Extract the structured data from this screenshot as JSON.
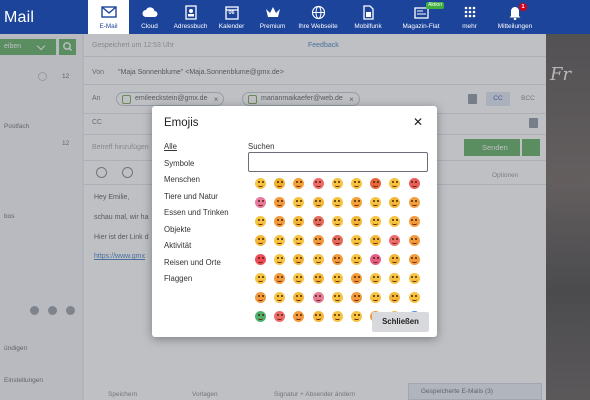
{
  "brand": {
    "name": "Mail"
  },
  "nav": [
    {
      "label": "E-Mail",
      "icon": "envelope-icon",
      "active": true
    },
    {
      "label": "Cloud",
      "icon": "cloud-icon"
    },
    {
      "label": "Adressbuch",
      "icon": "address-book-icon"
    },
    {
      "label": "Kalender",
      "icon": "calendar-icon",
      "day": "06"
    },
    {
      "label": "Premium",
      "icon": "crown-icon"
    },
    {
      "label": "Ihre Webseite",
      "icon": "globe-icon"
    },
    {
      "label": "Mobilfunk",
      "icon": "sim-card-icon"
    },
    {
      "label": "Magazin-Flat",
      "icon": "magazine-icon",
      "pill": "Aktion"
    },
    {
      "label": "mehr",
      "icon": "grid-icon"
    },
    {
      "label": "Mitteilungen",
      "icon": "bell-icon",
      "badge": "1"
    }
  ],
  "sidebar": {
    "compose_label": "eiben",
    "folder_count_1": "12",
    "folder_label_1": "Postfach",
    "folder_count_2": "12",
    "folder_label_3": "bos",
    "bottom_item_1": "ündigen",
    "bottom_item_2": "Einstellungen"
  },
  "compose": {
    "autosave": "Gespeichert um 12:53 Uhr",
    "feedback": "Feedback",
    "from_label": "Von",
    "from_value": "\"Maja Sonnenblume\" <Maja.Sonnenblume@gmx.de>",
    "to_label": "An",
    "recipients": [
      "emileeckstein@gmx.de",
      "marianmaikaefer@web.de"
    ],
    "cc_label": "CC",
    "bcc_label": "BCC",
    "cc_row_label": "CC",
    "subject_label": "Betreff hinzufügen",
    "send_label": "Senden",
    "options_label": "Optionen",
    "body_lines": [
      "Hey Emilie,",
      "schau mal, wir ha",
      "Hier ist der Link d",
      "https://www.gmx"
    ],
    "footer_items": [
      "Speichern",
      "Vorlagen",
      "Signatur + Absender ändern"
    ],
    "drafts_label": "Gespeicherte E-Mails (3)"
  },
  "ad": {
    "text": "Fr"
  },
  "dialog": {
    "title": "Emojis",
    "search_label": "Suchen",
    "search_value": "",
    "close_label": "Schließen",
    "categories": [
      "Alle",
      "Symbole",
      "Menschen",
      "Tiere und Natur",
      "Essen und Trinken",
      "Objekte",
      "Aktivität",
      "Reisen und Orte",
      "Flaggen"
    ],
    "emoji_colors": [
      "#f6c343",
      "#f0b030",
      "#f3a23a",
      "#ef6b6b",
      "#f6c343",
      "#f6c343",
      "#e8663c",
      "#f6c343",
      "#e95d5d",
      "#e77aa0",
      "#f39a3c",
      "#f6c343",
      "#f4b73a",
      "#f6c343",
      "#f3a23a",
      "#f6c343",
      "#f4b73a",
      "#f0a040",
      "#f6c343",
      "#f39a3c",
      "#f4b73a",
      "#e66a5e",
      "#f6c343",
      "#f4b73a",
      "#f6c343",
      "#f6c343",
      "#f39a3c",
      "#f4b73a",
      "#f6c343",
      "#f6c343",
      "#f39a3c",
      "#e66a5e",
      "#f6c343",
      "#f4b73a",
      "#ef6b6b",
      "#f39a3c",
      "#ef4b5b",
      "#f6c343",
      "#f4b73a",
      "#f6c343",
      "#f39a3c",
      "#f6c343",
      "#e85c8a",
      "#f4b73a",
      "#f39a3c",
      "#f6c343",
      "#f39a3c",
      "#f6c343",
      "#f4b73a",
      "#f6c343",
      "#f39a3c",
      "#f6c343",
      "#f6c343",
      "#f6c343",
      "#f39a3c",
      "#f6c343",
      "#f4b73a",
      "#e87a9a",
      "#f6c343",
      "#f39a3c",
      "#f6c343",
      "#f4b73a",
      "#f6c343",
      "#4fb070",
      "#ef6b6b",
      "#f39a3c",
      "#f4b73a",
      "#f6c343",
      "#f6c343",
      "#f39a3c",
      "#f4b73a",
      "#3f8fe0"
    ]
  }
}
